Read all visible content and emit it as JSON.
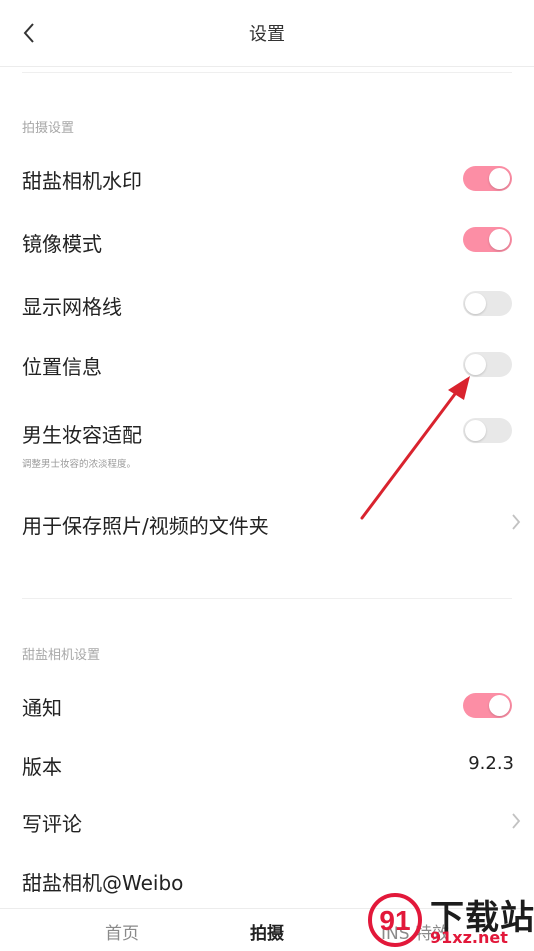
{
  "header": {
    "title": "设置"
  },
  "sections": {
    "shooting": {
      "title": "拍摄设置",
      "items": [
        {
          "label": "甜盐相机水印",
          "toggle": true
        },
        {
          "label": "镜像模式",
          "toggle": true
        },
        {
          "label": "显示网格线",
          "toggle": false
        },
        {
          "label": "位置信息",
          "toggle": false
        },
        {
          "label": "男生妆容适配",
          "sublabel": "调整男士妆容的浓淡程度。",
          "toggle": false
        },
        {
          "label": "用于保存照片/视频的文件夹"
        }
      ]
    },
    "app": {
      "title": "甜盐相机设置",
      "items": [
        {
          "label": "通知",
          "toggle": true
        },
        {
          "label": "版本",
          "value": "9.2.3"
        },
        {
          "label": "写评论"
        },
        {
          "label": "甜盐相机@Weibo"
        }
      ]
    }
  },
  "tabbar": {
    "tabs": [
      {
        "label": "首页"
      },
      {
        "label": "拍摄",
        "active": true
      },
      {
        "label": "INS 特效"
      }
    ]
  },
  "watermark": {
    "text": "下载站",
    "url": "91xz.net",
    "logo": "91"
  },
  "colors": {
    "toggle_on": "#fc8ea5",
    "toggle_off": "#e8e8e8",
    "arrow": "#d9232e"
  },
  "icons": {
    "back": "chevron-left-icon",
    "forward": "chevron-right-icon"
  }
}
